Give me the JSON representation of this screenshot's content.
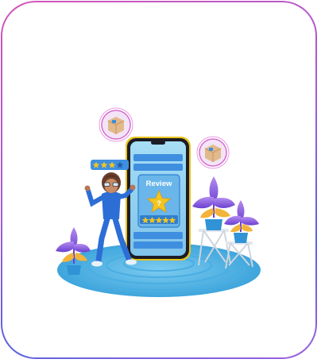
{
  "illustration": {
    "review_label": "Review",
    "review_symbol": "?",
    "stars_filled": 5,
    "bubble_stars_filled": 3,
    "bubble_stars_total": 4,
    "colors": {
      "border_start": "#d455b8",
      "border_end": "#5a63e0",
      "phone_body": "#1c1c24",
      "phone_trim": "#e8c21a",
      "screen": "#8fd0ee",
      "screen_bar": "#3f8fe0",
      "star": "#f2c521",
      "platform": "#5cb8e6",
      "plant_leaf": "#8a5fe0",
      "plant_pot": "#2f93d6",
      "box": "#e2b98a"
    },
    "icons": [
      "floating-box-icon",
      "floating-box-icon",
      "star-icon"
    ]
  }
}
